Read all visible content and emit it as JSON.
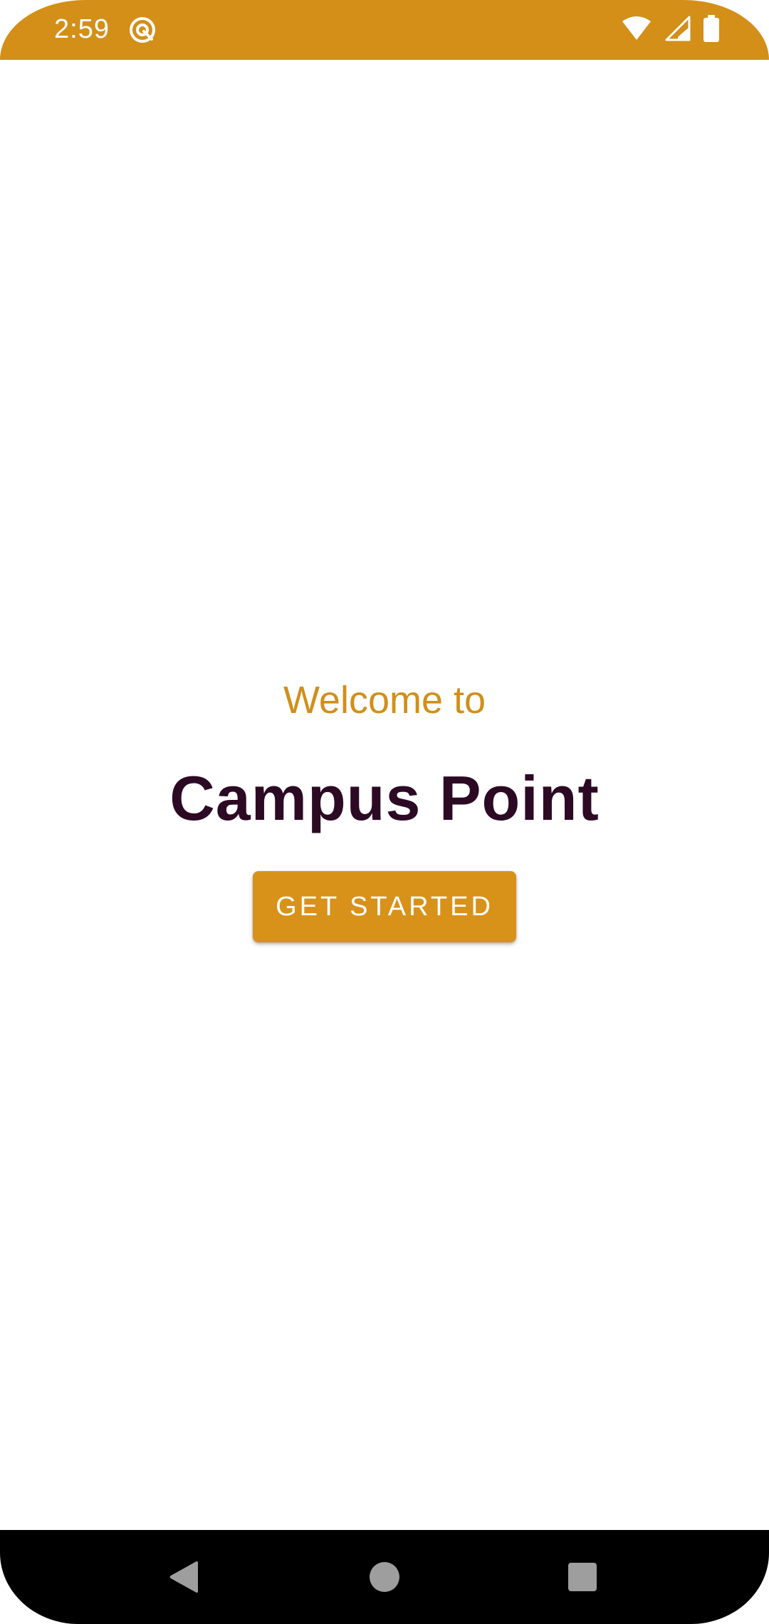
{
  "status_bar": {
    "time": "2:59",
    "background_color": "#d38f18",
    "icons": [
      "app-notification-icon",
      "wifi-icon",
      "cellular-signal-icon",
      "battery-icon"
    ]
  },
  "welcome": {
    "subtitle": "Welcome to",
    "title": "Campus Point",
    "subtitle_color": "#d08f1c",
    "title_color": "#2c0a24"
  },
  "actions": {
    "get_started_label": "GET STARTED",
    "button_color": "#d8921a"
  },
  "navigation_bar": {
    "icons": [
      "back-icon",
      "home-icon",
      "recents-icon"
    ]
  }
}
